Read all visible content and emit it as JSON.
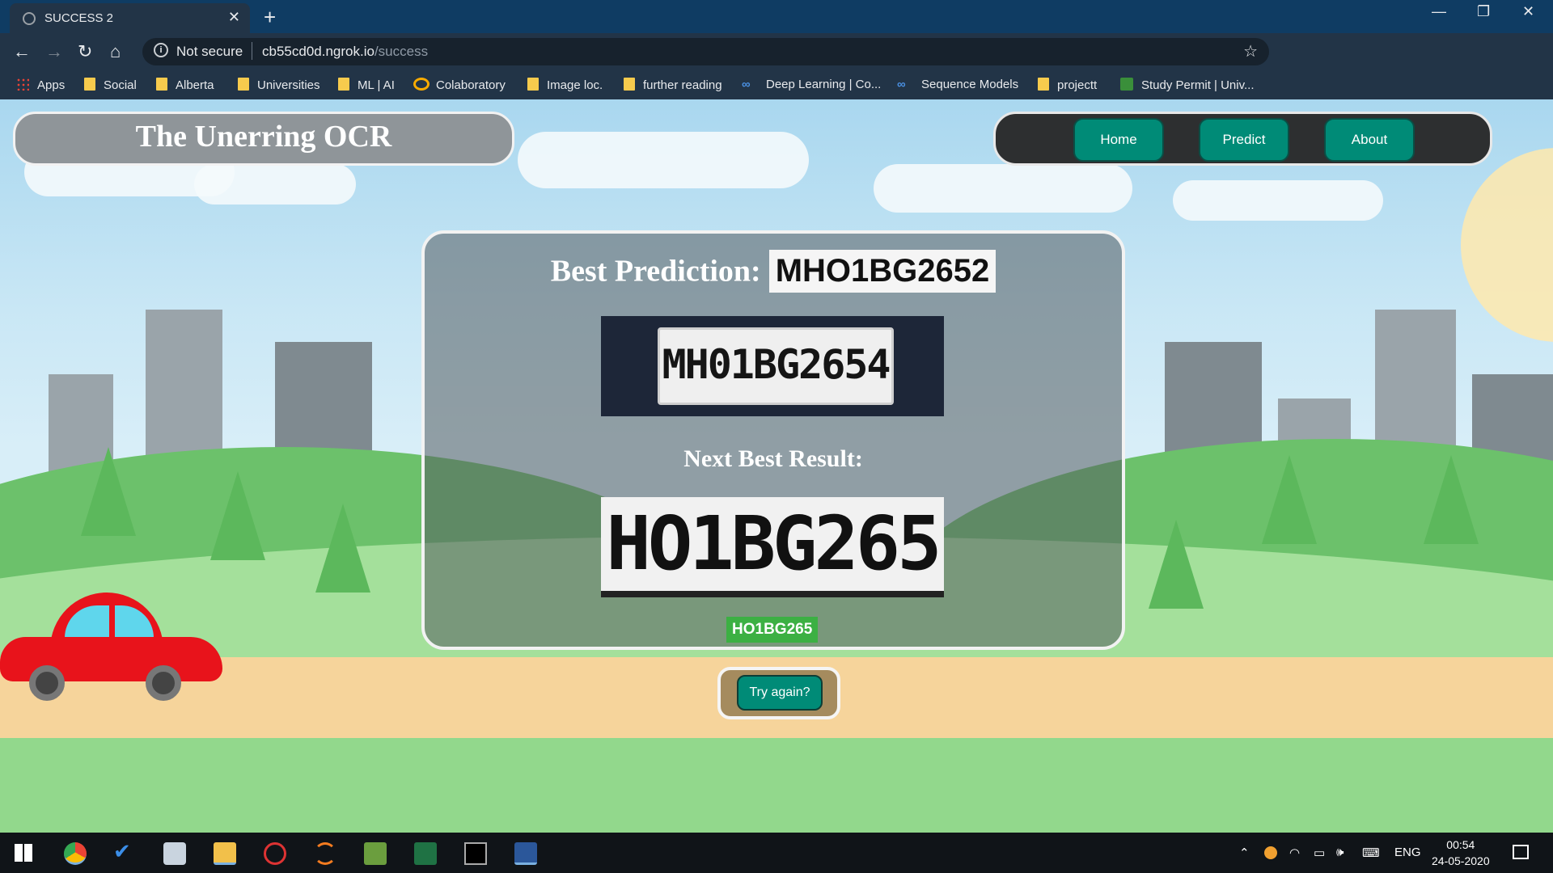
{
  "browser": {
    "tab_title": "SUCCESS 2",
    "new_tab": "+",
    "security": "Not secure",
    "url_host": "cb55cd0d.ngrok.io",
    "url_path": "/success",
    "bookmarks": [
      "Apps",
      "Social",
      "Alberta",
      "Universities",
      "ML | AI",
      "Colaboratory",
      "Image loc.",
      "further reading",
      "Deep Learning | Co...",
      "Sequence Models",
      "projectt",
      "Study Permit | Univ..."
    ]
  },
  "header": {
    "brand": "The Unerring OCR",
    "nav": [
      "Home",
      "Predict",
      "About"
    ]
  },
  "result": {
    "best_label": "Best Prediction:",
    "best_value": "MHO1BG2652",
    "plate_image_text": "MH01BG2654",
    "next_label": "Next Best Result:",
    "next_image_text": "HO1BG265",
    "next_value": "HO1BG265",
    "try_again": "Try again?"
  },
  "taskbar": {
    "language": "ENG",
    "time": "00:54",
    "date": "24-05-2020"
  },
  "colors": {
    "button_teal": "#008b77",
    "tag_green": "#3cb043",
    "tab_bar": "#0f3c63",
    "car_red": "#e8131b"
  }
}
